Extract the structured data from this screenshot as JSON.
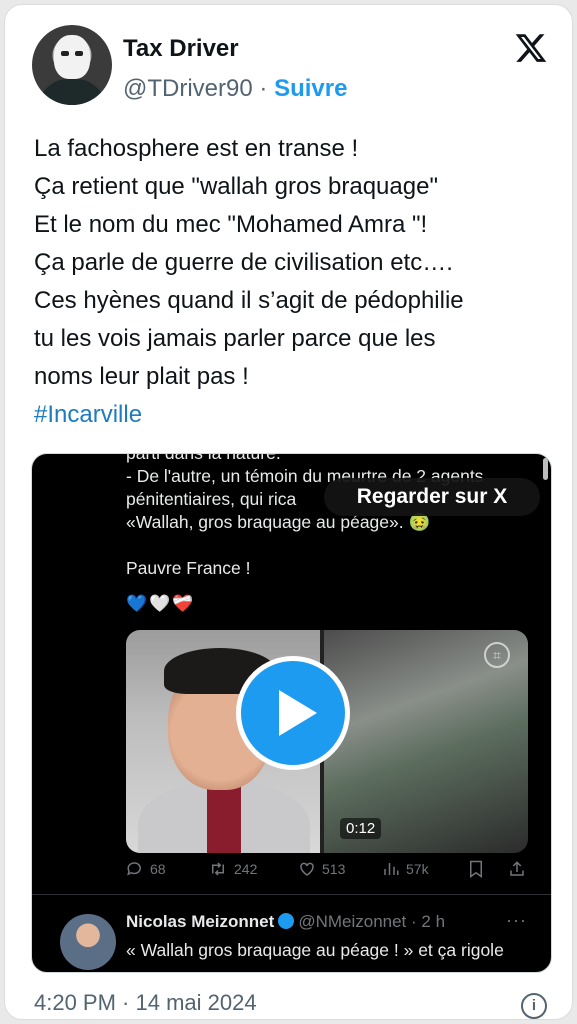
{
  "author": {
    "name": "Tax Driver",
    "handle": "@TDriver90",
    "separator": "·",
    "follow_label": "Suivre"
  },
  "tweet": {
    "lines": [
      "La fachosphere est en transe !",
      "Ça retient que \"wallah gros braquage\"",
      "Et le nom du mec \"Mohamed Amra \"!",
      "Ça parle de guerre de civilisation etc….",
      "Ces hyènes quand il s’agit de pédophilie",
      "tu les vois jamais parler parce que les",
      "noms leur plait pas !"
    ],
    "hashtag": "#Incarville"
  },
  "media": {
    "watch_label": "Regarder sur X",
    "quote_lines": [
      "parti dans la nature.",
      "- De l'autre, un témoin du meurtre de 2 agents",
      "pénitentiaires, qui rica",
      "«Wallah, gros braquage au péage». 🤢",
      "",
      "Pauvre France !"
    ],
    "hearts": "💙🤍❤️‍🩹",
    "video_duration": "0:12",
    "metrics": {
      "replies": "68",
      "reposts": "242",
      "likes": "513",
      "views": "57k"
    },
    "reply": {
      "name": "Nicolas Meizonnet",
      "handle": "@NMeizonnet",
      "time": "· 2 h",
      "more": "···",
      "text": "« Wallah gros braquage au péage ! » et ça rigole"
    }
  },
  "footer": {
    "timestamp": "4:20 PM · 14 mai 2024",
    "info_icon": "i"
  },
  "colors": {
    "accent": "#1d9bf0",
    "hashtag": "#1d7bc0",
    "muted": "#536471"
  }
}
